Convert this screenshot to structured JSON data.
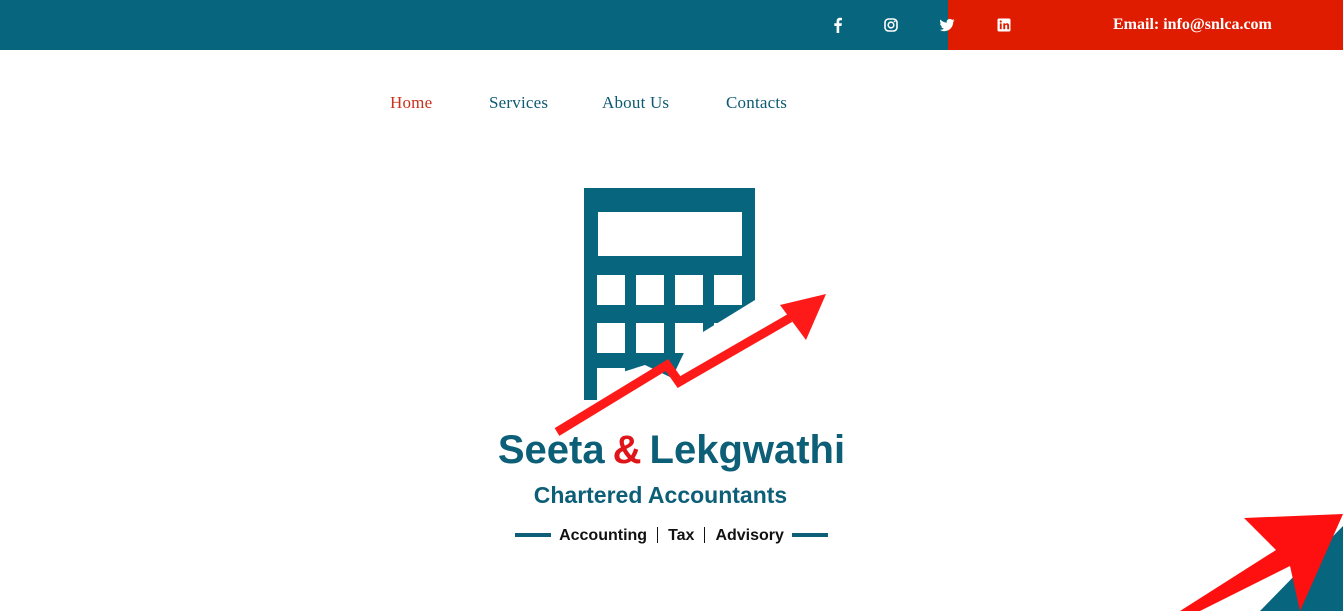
{
  "topbar": {
    "colors": {
      "primary": "#07657d",
      "accent": "#df1c00"
    },
    "social": [
      {
        "icon": "facebook-icon"
      },
      {
        "icon": "instagram-icon"
      },
      {
        "icon": "twitter-icon"
      },
      {
        "icon": "linkedin-icon"
      }
    ],
    "email_label": "Email: info@snlca.com"
  },
  "nav": {
    "items": [
      {
        "label": "Home",
        "active": true
      },
      {
        "label": "Services",
        "active": false
      },
      {
        "label": "About Us",
        "active": false
      },
      {
        "label": "Contacts",
        "active": false
      }
    ]
  },
  "logo": {
    "name_part1": "Seeta",
    "ampersand": "&",
    "name_part2": "Lekgwathi",
    "subtitle": "Chartered Accountants",
    "tagline": [
      "Accounting",
      "Tax",
      "Advisory"
    ],
    "colors": {
      "teal": "#0d5f78",
      "red": "#e0151a"
    },
    "icons": [
      "calculator-icon",
      "growth-arrow-icon"
    ]
  }
}
